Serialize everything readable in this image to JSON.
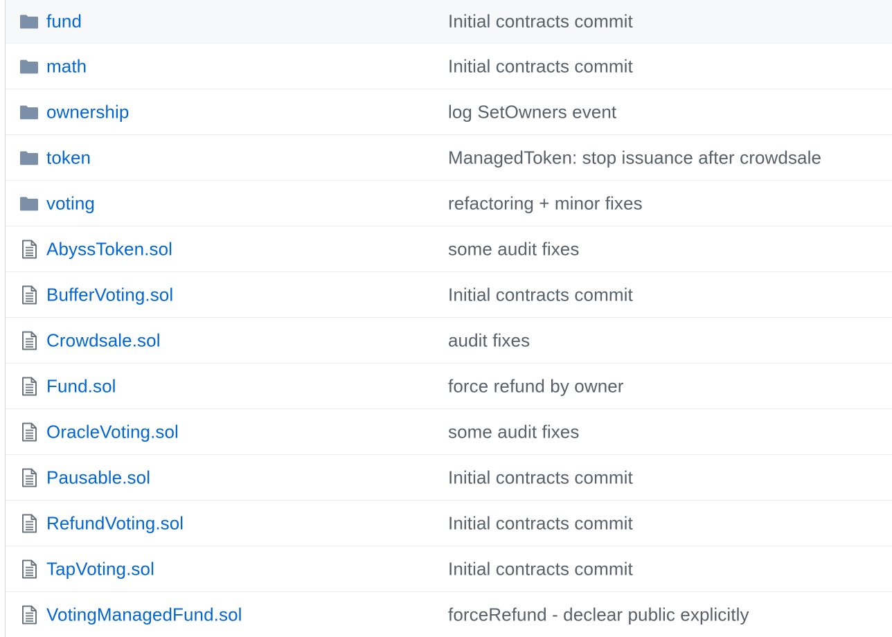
{
  "colors": {
    "link": "#0366d6",
    "message": "#586069",
    "folder_icon": "#79b8ff",
    "file_icon": "#6a737d",
    "row_border": "#eaecef"
  },
  "files": [
    {
      "type": "folder",
      "icon": "folder-icon",
      "name": "fund",
      "message": "Initial contracts commit"
    },
    {
      "type": "folder",
      "icon": "folder-icon",
      "name": "math",
      "message": "Initial contracts commit"
    },
    {
      "type": "folder",
      "icon": "folder-icon",
      "name": "ownership",
      "message": "log SetOwners event"
    },
    {
      "type": "folder",
      "icon": "folder-icon",
      "name": "token",
      "message": "ManagedToken: stop issuance after crowdsale"
    },
    {
      "type": "folder",
      "icon": "folder-icon",
      "name": "voting",
      "message": "refactoring + minor fixes"
    },
    {
      "type": "file",
      "icon": "file-icon",
      "name": "AbyssToken.sol",
      "message": "some audit fixes"
    },
    {
      "type": "file",
      "icon": "file-icon",
      "name": "BufferVoting.sol",
      "message": "Initial contracts commit"
    },
    {
      "type": "file",
      "icon": "file-icon",
      "name": "Crowdsale.sol",
      "message": "audit fixes"
    },
    {
      "type": "file",
      "icon": "file-icon",
      "name": "Fund.sol",
      "message": "force refund by owner"
    },
    {
      "type": "file",
      "icon": "file-icon",
      "name": "OracleVoting.sol",
      "message": "some audit fixes"
    },
    {
      "type": "file",
      "icon": "file-icon",
      "name": "Pausable.sol",
      "message": "Initial contracts commit"
    },
    {
      "type": "file",
      "icon": "file-icon",
      "name": "RefundVoting.sol",
      "message": "Initial contracts commit"
    },
    {
      "type": "file",
      "icon": "file-icon",
      "name": "TapVoting.sol",
      "message": "Initial contracts commit"
    },
    {
      "type": "file",
      "icon": "file-icon",
      "name": "VotingManagedFund.sol",
      "message": "forceRefund - declear public explicitly"
    }
  ]
}
